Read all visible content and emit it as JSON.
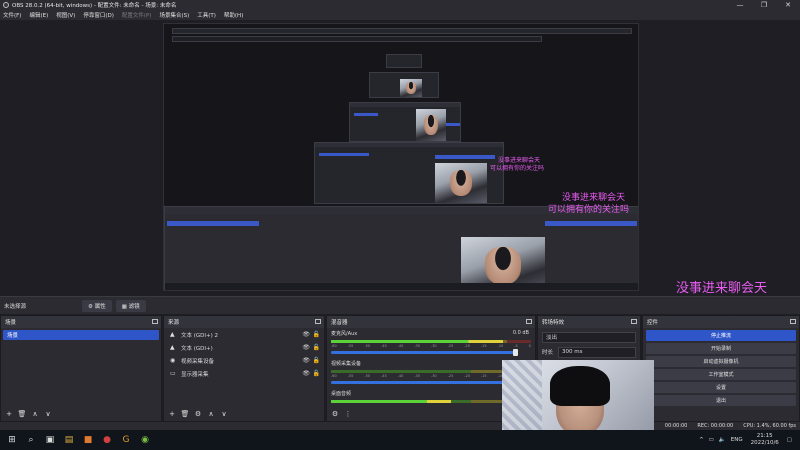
{
  "window": {
    "title": "OBS 28.0.2 (64-bit, windows) - 配置文件: 未命名 - 场景: 未命名",
    "controls": [
      "—",
      "❐",
      "✕"
    ]
  },
  "menu": [
    {
      "label": "文件(F)",
      "disabled": false
    },
    {
      "label": "编辑(E)",
      "disabled": false
    },
    {
      "label": "视图(V)",
      "disabled": false
    },
    {
      "label": "停靠窗口(D)",
      "disabled": false
    },
    {
      "label": "配置文件(P)",
      "disabled": true
    },
    {
      "label": "场景集合(S)",
      "disabled": false
    },
    {
      "label": "工具(T)",
      "disabled": false
    },
    {
      "label": "帮助(H)",
      "disabled": false
    }
  ],
  "overlay": {
    "line1": "没事进来聊会天",
    "line2": "可以拥有你的关注吗",
    "color": "#e85cf0"
  },
  "scene_strip": {
    "label": "未选择源",
    "properties": "⚙ 属性",
    "filters": "▦ 滤镜"
  },
  "scenes": {
    "title": "场景",
    "items": [
      "场景"
    ],
    "footer": [
      "+",
      "🗑",
      "∧",
      "∨"
    ]
  },
  "sources": {
    "title": "来源",
    "items": [
      {
        "icon": "▲",
        "label": "文本 (GDI+) 2"
      },
      {
        "icon": "▲",
        "label": "文本 (GDI+)"
      },
      {
        "icon": "◉",
        "label": "视频采集设备"
      },
      {
        "icon": "▭",
        "label": "显示器采集"
      }
    ],
    "footer": [
      "+",
      "🗑",
      "⚙",
      "∧",
      "∨"
    ]
  },
  "mixer": {
    "title": "混音器",
    "channels": [
      {
        "name": "麦克风/Aux",
        "db": "0.0 dB",
        "level": 0.86
      },
      {
        "name": "视频采集设备",
        "db": "",
        "level": 0.0
      },
      {
        "name": "桌面音频",
        "db": "",
        "level": 0.6
      }
    ],
    "scale": [
      "-60",
      "-55",
      "-50",
      "-45",
      "-40",
      "-35",
      "-30",
      "-25",
      "-20",
      "-15",
      "-10",
      "-5",
      "0"
    ],
    "footer": [
      "⚙",
      "⋮"
    ]
  },
  "transitions": {
    "title": "转场特效",
    "type": "淡出",
    "duration_label": "时长",
    "duration": "300 ms"
  },
  "controls": {
    "title": "控件",
    "buttons": [
      "停止推流",
      "开始录制",
      "启动虚拟摄像机",
      "工作室模式",
      "设置",
      "退出"
    ]
  },
  "status": {
    "live": "00:00:00",
    "rec": "REC: 00:00:00",
    "cpu": "CPU: 1.4%, 60.00 fps"
  },
  "taskbar": {
    "lang": "ENG",
    "time": "21:15",
    "date": "2022/10/6"
  }
}
